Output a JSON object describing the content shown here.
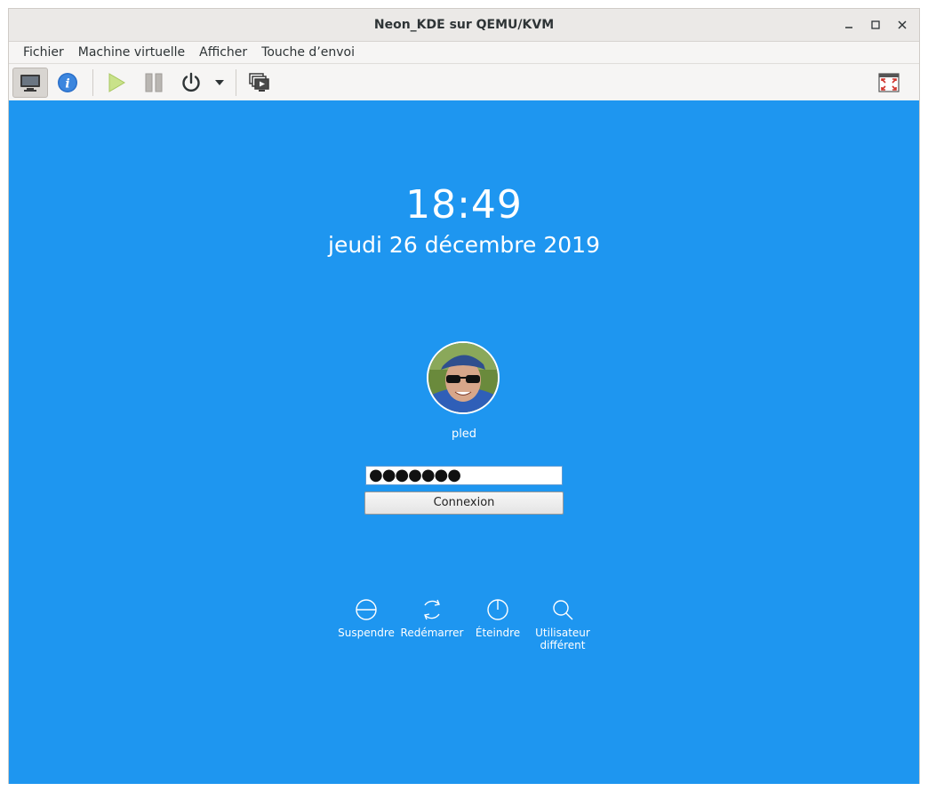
{
  "window": {
    "title": "Neon_KDE sur QEMU/KVM"
  },
  "menubar": {
    "items": [
      "Fichier",
      "Machine virtuelle",
      "Afficher",
      "Touche d’envoi"
    ]
  },
  "toolbar": {
    "buttons": [
      "console-icon",
      "info-icon",
      "play-icon",
      "pause-icon",
      "power-icon",
      "dropdown-arrow-icon",
      "snapshots-icon",
      "fullscreen-icon"
    ]
  },
  "lockscreen": {
    "time": "18:49",
    "date": "jeudi 26 décembre 2019",
    "username": "pled",
    "password_mask": "●●●●●●●",
    "login_label": "Connexion",
    "actions": [
      {
        "label": "Suspendre",
        "icon": "suspend-icon"
      },
      {
        "label": "Redémarrer",
        "icon": "restart-icon"
      },
      {
        "label": "Éteindre",
        "icon": "shutdown-icon"
      },
      {
        "label": "Utilisateur différent",
        "icon": "search-user-icon"
      }
    ]
  },
  "colors": {
    "screen_bg": "#1e96f0",
    "text": "#ffffff"
  }
}
